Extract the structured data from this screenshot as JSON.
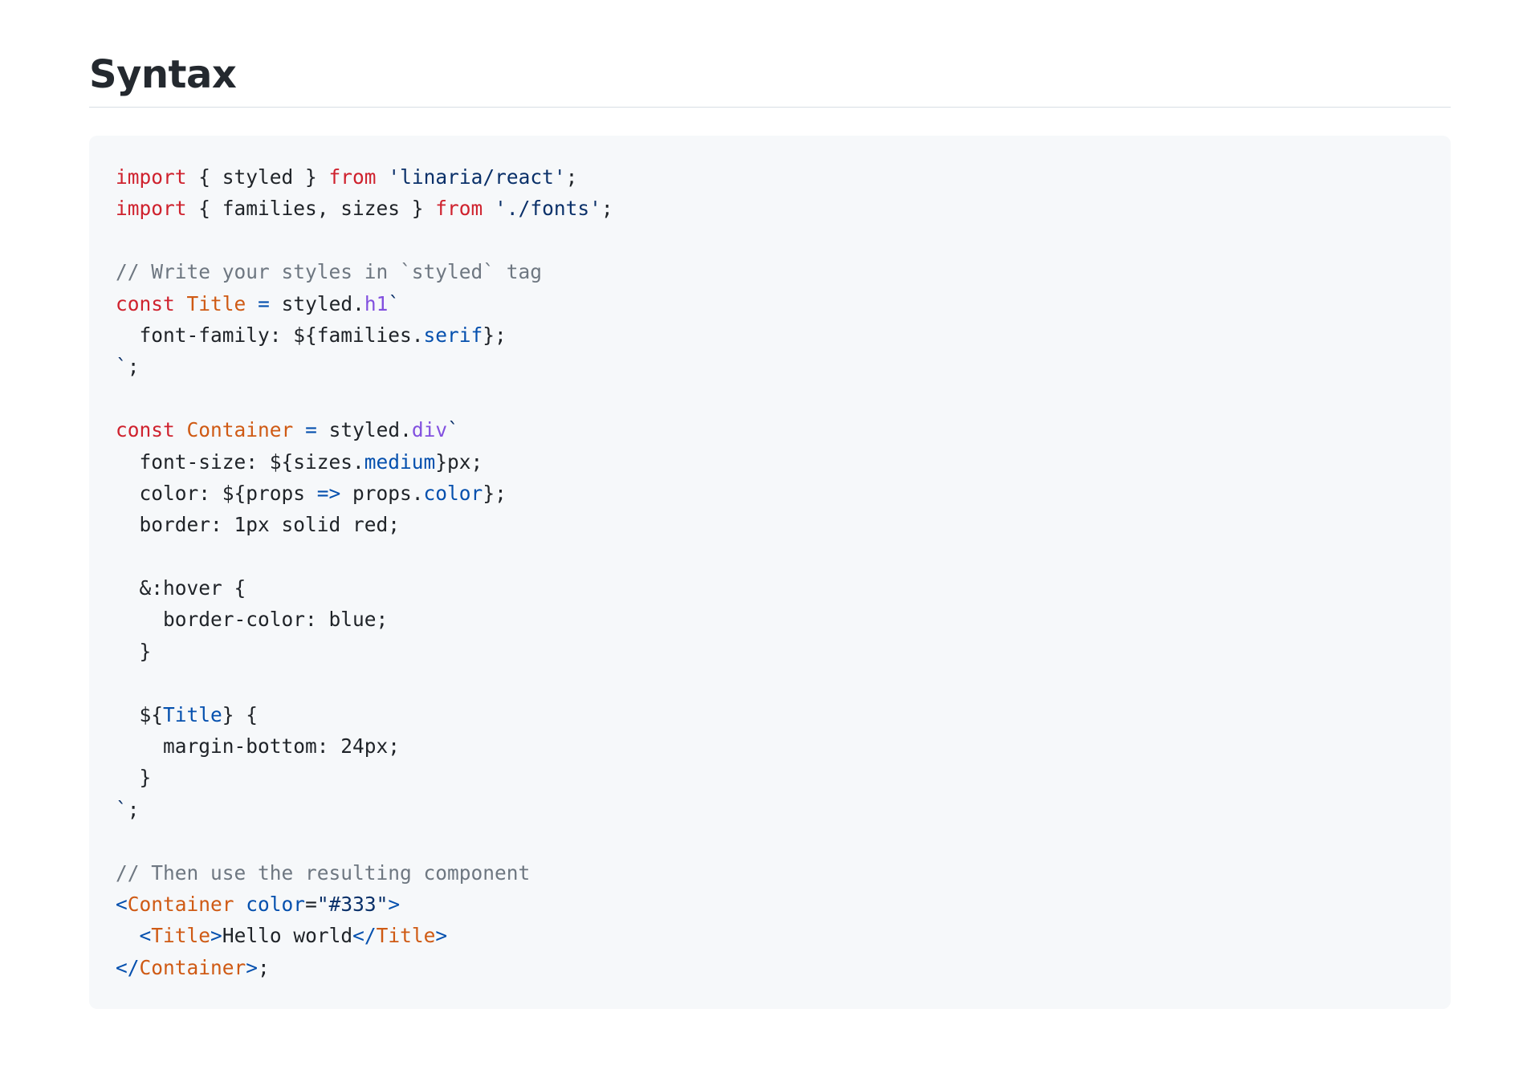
{
  "heading": "Syntax",
  "colors": {
    "keyword": "#cf222e",
    "string": "#0a3069",
    "comment": "#6e7781",
    "class_name": "#cf5a14",
    "tag_property": "#8250df",
    "member": "#0550ae",
    "code_background": "#f6f8fa",
    "text": "#1f2328"
  },
  "code": {
    "language": "jsx",
    "lines": [
      [
        {
          "t": "kw",
          "v": "import"
        },
        {
          "t": "pl",
          "v": " { styled } "
        },
        {
          "t": "kw",
          "v": "from"
        },
        {
          "t": "pl",
          "v": " "
        },
        {
          "t": "str",
          "v": "'linaria/react'"
        },
        {
          "t": "pl",
          "v": ";"
        }
      ],
      [
        {
          "t": "kw",
          "v": "import"
        },
        {
          "t": "pl",
          "v": " { families, sizes } "
        },
        {
          "t": "kw",
          "v": "from"
        },
        {
          "t": "pl",
          "v": " "
        },
        {
          "t": "str",
          "v": "'./fonts'"
        },
        {
          "t": "pl",
          "v": ";"
        }
      ],
      [],
      [
        {
          "t": "cm",
          "v": "// Write your styles in `styled` tag"
        }
      ],
      [
        {
          "t": "kw",
          "v": "const"
        },
        {
          "t": "pl",
          "v": " "
        },
        {
          "t": "cls",
          "v": "Title"
        },
        {
          "t": "pl",
          "v": " "
        },
        {
          "t": "op",
          "v": "="
        },
        {
          "t": "pl",
          "v": " styled."
        },
        {
          "t": "prop",
          "v": "h1"
        },
        {
          "t": "str",
          "v": "`"
        }
      ],
      [
        {
          "t": "pl",
          "v": "  font-family: ${families."
        },
        {
          "t": "mem",
          "v": "serif"
        },
        {
          "t": "pl",
          "v": "};"
        }
      ],
      [
        {
          "t": "str",
          "v": "`"
        },
        {
          "t": "pl",
          "v": ";"
        }
      ],
      [],
      [
        {
          "t": "kw",
          "v": "const"
        },
        {
          "t": "pl",
          "v": " "
        },
        {
          "t": "cls",
          "v": "Container"
        },
        {
          "t": "pl",
          "v": " "
        },
        {
          "t": "op",
          "v": "="
        },
        {
          "t": "pl",
          "v": " styled."
        },
        {
          "t": "prop",
          "v": "div"
        },
        {
          "t": "str",
          "v": "`"
        }
      ],
      [
        {
          "t": "pl",
          "v": "  font-size: ${sizes."
        },
        {
          "t": "mem",
          "v": "medium"
        },
        {
          "t": "pl",
          "v": "}px;"
        }
      ],
      [
        {
          "t": "pl",
          "v": "  color: ${props "
        },
        {
          "t": "op",
          "v": "=>"
        },
        {
          "t": "pl",
          "v": " props."
        },
        {
          "t": "mem",
          "v": "color"
        },
        {
          "t": "pl",
          "v": "};"
        }
      ],
      [
        {
          "t": "pl",
          "v": "  border: 1px solid red;"
        }
      ],
      [],
      [
        {
          "t": "pl",
          "v": "  &:hover {"
        }
      ],
      [
        {
          "t": "pl",
          "v": "    border-color: blue;"
        }
      ],
      [
        {
          "t": "pl",
          "v": "  }"
        }
      ],
      [],
      [
        {
          "t": "pl",
          "v": "  ${"
        },
        {
          "t": "mem",
          "v": "Title"
        },
        {
          "t": "pl",
          "v": "} {"
        }
      ],
      [
        {
          "t": "pl",
          "v": "    margin-bottom: 24px;"
        }
      ],
      [
        {
          "t": "pl",
          "v": "  }"
        }
      ],
      [
        {
          "t": "str",
          "v": "`"
        },
        {
          "t": "pl",
          "v": ";"
        }
      ],
      [],
      [
        {
          "t": "cm",
          "v": "// Then use the resulting component"
        }
      ],
      [
        {
          "t": "tag",
          "v": "<"
        },
        {
          "t": "cls",
          "v": "Container"
        },
        {
          "t": "pl",
          "v": " "
        },
        {
          "t": "tag",
          "v": "color"
        },
        {
          "t": "pl",
          "v": "="
        },
        {
          "t": "str",
          "v": "\"#333\""
        },
        {
          "t": "tag",
          "v": ">"
        }
      ],
      [
        {
          "t": "pl",
          "v": "  "
        },
        {
          "t": "tag",
          "v": "<"
        },
        {
          "t": "cls",
          "v": "Title"
        },
        {
          "t": "tag",
          "v": ">"
        },
        {
          "t": "pl",
          "v": "Hello world"
        },
        {
          "t": "tag",
          "v": "</"
        },
        {
          "t": "cls",
          "v": "Title"
        },
        {
          "t": "tag",
          "v": ">"
        }
      ],
      [
        {
          "t": "tag",
          "v": "</"
        },
        {
          "t": "cls",
          "v": "Container"
        },
        {
          "t": "tag",
          "v": ">"
        },
        {
          "t": "pl",
          "v": ";"
        }
      ]
    ]
  }
}
